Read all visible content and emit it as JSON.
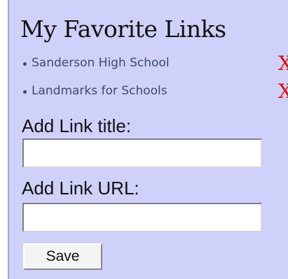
{
  "widget": {
    "title": "My Favorite Links",
    "links": [
      {
        "label": "Sanderson High School",
        "remove_label": "X"
      },
      {
        "label": "Landmarks for Schools",
        "remove_label": "X"
      }
    ],
    "add_title_label": "Add Link title:",
    "add_title_value": "",
    "add_url_label": "Add Link URL:",
    "add_url_value": "",
    "save_label": "Save"
  },
  "colors": {
    "panel_background": "#cfd1fb",
    "link_text": "#3b4a73",
    "remove_x": "#d21414"
  }
}
